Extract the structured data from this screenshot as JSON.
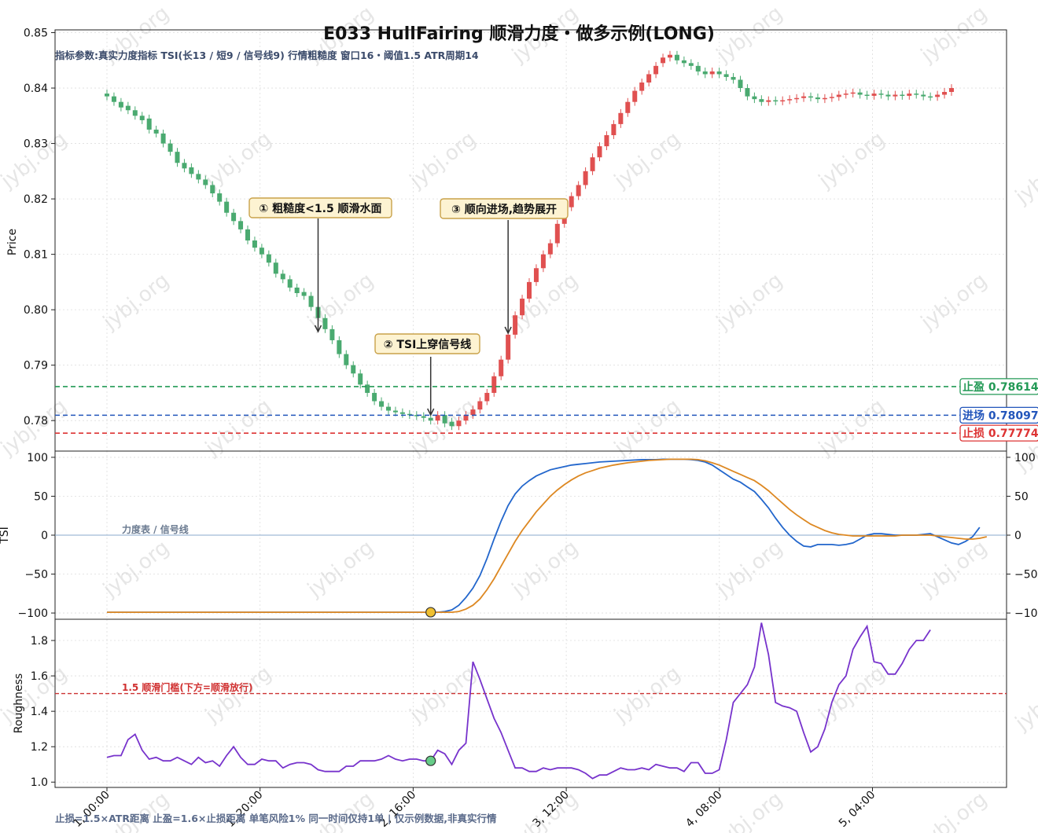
{
  "title": "E033 HullFairing 顺滑力度・做多示例(LONG)",
  "subtitle": "指标参数:真实力度指标 TSI(长13 / 短9 / 信号线9)   行情粗糙度 窗口16・阈值1.5   ATR周期14",
  "footer": "止损=1.5×ATR距离   止盈=1.6×止损距离   单笔风险1%   同一时间仅持1单   |   仅示例数据,非真实行情",
  "watermark": "jybj.org",
  "colors": {
    "up": "#e05050",
    "down": "#4aaa70",
    "tsi": "#2266cc",
    "signal": "#dd8822",
    "rough": "#7733cc",
    "tp": "#229955",
    "entry": "#2255bb",
    "sl": "#dd3333"
  },
  "chart_data": [
    {
      "type": "candlestick",
      "panel": "price",
      "ylabel": "Price",
      "ylim": [
        0.7745,
        0.8505
      ],
      "yticks": [
        "0.78",
        "0.79",
        "0.80",
        "0.81",
        "0.82",
        "0.83",
        "0.84",
        "0.85"
      ],
      "xticks": [
        "1, 00:00",
        "1, 20:00",
        "2, 16:00",
        "3, 12:00",
        "4, 08:00",
        "5, 04:00"
      ],
      "series_note": "121 hourly candles, values read off the chart",
      "lines": [
        {
          "name": "止盈",
          "value": 0.78614,
          "label": "止盈 0.78614"
        },
        {
          "name": "进场",
          "value": 0.78097,
          "label": "进场 0.78097"
        },
        {
          "name": "止损",
          "value": 0.77774,
          "label": "止损 0.77774"
        }
      ],
      "annotations": [
        {
          "text": "① 粗糙度<1.5 顺滑水面",
          "index": 30
        },
        {
          "text": "② TSI上穿信号线",
          "index": 46
        },
        {
          "text": "③ 顺向进场,趋势展开",
          "index": 57
        }
      ],
      "closes": [
        0.8385,
        0.8375,
        0.8365,
        0.836,
        0.835,
        0.8342,
        0.8325,
        0.8318,
        0.83,
        0.8285,
        0.8265,
        0.8255,
        0.8245,
        0.8235,
        0.8225,
        0.821,
        0.8195,
        0.8175,
        0.816,
        0.8145,
        0.8125,
        0.8112,
        0.81,
        0.8085,
        0.8065,
        0.8055,
        0.804,
        0.803,
        0.8025,
        0.8005,
        0.7985,
        0.7965,
        0.7945,
        0.792,
        0.79,
        0.7885,
        0.7865,
        0.785,
        0.7835,
        0.7825,
        0.7818,
        0.7815,
        0.7812,
        0.781,
        0.7808,
        0.7805,
        0.78,
        0.781,
        0.7795,
        0.779,
        0.78,
        0.781,
        0.782,
        0.7835,
        0.785,
        0.788,
        0.791,
        0.7955,
        0.799,
        0.802,
        0.805,
        0.8075,
        0.81,
        0.812,
        0.8155,
        0.8185,
        0.8205,
        0.8225,
        0.825,
        0.8275,
        0.8295,
        0.8315,
        0.8335,
        0.8355,
        0.8375,
        0.8395,
        0.841,
        0.8425,
        0.844,
        0.8455,
        0.846,
        0.845,
        0.8445,
        0.844,
        0.843,
        0.8425,
        0.843,
        0.8425,
        0.842,
        0.8415,
        0.84,
        0.8385,
        0.838,
        0.8375,
        0.8378,
        0.8376,
        0.8378,
        0.838,
        0.8382,
        0.8385,
        0.8383,
        0.838,
        0.8382,
        0.8384,
        0.8388,
        0.839,
        0.8392,
        0.8388,
        0.8386,
        0.839,
        0.8388,
        0.8385,
        0.8388,
        0.8386,
        0.839,
        0.8388,
        0.8385,
        0.8384,
        0.8388,
        0.8393,
        0.84
      ],
      "opens": [
        0.839,
        0.8385,
        0.8375,
        0.8368,
        0.836,
        0.835,
        0.8345,
        0.8325,
        0.8318,
        0.83,
        0.8285,
        0.8265,
        0.8257,
        0.8245,
        0.8235,
        0.8225,
        0.821,
        0.8195,
        0.8175,
        0.816,
        0.8145,
        0.8125,
        0.8112,
        0.81,
        0.8085,
        0.8065,
        0.8055,
        0.804,
        0.8032,
        0.8025,
        0.8005,
        0.7985,
        0.7965,
        0.7945,
        0.792,
        0.79,
        0.7885,
        0.7865,
        0.785,
        0.7835,
        0.7825,
        0.7818,
        0.7815,
        0.7812,
        0.781,
        0.7808,
        0.7805,
        0.78,
        0.781,
        0.7798,
        0.779,
        0.78,
        0.781,
        0.782,
        0.7835,
        0.785,
        0.788,
        0.791,
        0.7955,
        0.799,
        0.802,
        0.805,
        0.8075,
        0.81,
        0.812,
        0.8155,
        0.8185,
        0.8205,
        0.8225,
        0.825,
        0.8275,
        0.8295,
        0.8315,
        0.8335,
        0.8355,
        0.8375,
        0.8395,
        0.841,
        0.8425,
        0.8445,
        0.8455,
        0.846,
        0.845,
        0.8445,
        0.844,
        0.843,
        0.8425,
        0.843,
        0.8425,
        0.842,
        0.8415,
        0.84,
        0.8385,
        0.838,
        0.8375,
        0.8378,
        0.8376,
        0.8378,
        0.838,
        0.8382,
        0.8385,
        0.8383,
        0.838,
        0.8382,
        0.8384,
        0.8388,
        0.839,
        0.8392,
        0.8388,
        0.8386,
        0.839,
        0.8388,
        0.8385,
        0.8388,
        0.8386,
        0.839,
        0.8388,
        0.8385,
        0.8384,
        0.8388,
        0.8393
      ]
    },
    {
      "type": "line",
      "panel": "tsi",
      "ylabel": "TSI",
      "label": "力度表 / 信号线",
      "ylim": [
        -108,
        108
      ],
      "yticks": [
        "100",
        "50",
        "0",
        "−50",
        "−100"
      ],
      "cross_index": 46,
      "series": [
        {
          "key": "tsi",
          "values": [
            -99,
            -99,
            -99,
            -99,
            -99,
            -99,
            -99,
            -99,
            -99,
            -99,
            -99,
            -99,
            -99,
            -99,
            -99,
            -99,
            -99,
            -99,
            -99,
            -99,
            -99,
            -99,
            -99,
            -99,
            -99,
            -99,
            -99,
            -99,
            -99,
            -99,
            -99,
            -99,
            -99,
            -99,
            -99,
            -99,
            -99,
            -99,
            -99,
            -99,
            -99,
            -99,
            -99,
            -99,
            -99,
            -99,
            -99,
            -99,
            -98,
            -96,
            -90,
            -80,
            -68,
            -52,
            -30,
            -5,
            18,
            38,
            53,
            63,
            70,
            76,
            80,
            84,
            86,
            88,
            90,
            91,
            92,
            93,
            94,
            94.5,
            95,
            95.5,
            96,
            96.5,
            97,
            97,
            97,
            97.5,
            97.5,
            97.5,
            97.5,
            97,
            96,
            94,
            90,
            84,
            78,
            72,
            68,
            62,
            56,
            46,
            35,
            22,
            10,
            0,
            -8,
            -14,
            -15,
            -12,
            -12,
            -12,
            -13,
            -12,
            -10,
            -5,
            0,
            2,
            2,
            1,
            0,
            0,
            0,
            0,
            1,
            2,
            -2,
            -6,
            -10,
            -12,
            -8,
            -2,
            10
          ]
        },
        {
          "key": "signal",
          "values": [
            -99,
            -99,
            -99,
            -99,
            -99,
            -99,
            -99,
            -99,
            -99,
            -99,
            -99,
            -99,
            -99,
            -99,
            -99,
            -99,
            -99,
            -99,
            -99,
            -99,
            -99,
            -99,
            -99,
            -99,
            -99,
            -99,
            -99,
            -99,
            -99,
            -99,
            -99,
            -99,
            -99,
            -99,
            -99,
            -99,
            -99,
            -99,
            -99,
            -99,
            -99,
            -99,
            -99,
            -99,
            -99,
            -99,
            -99,
            -99,
            -99,
            -99,
            -98,
            -95,
            -90,
            -82,
            -70,
            -56,
            -40,
            -24,
            -8,
            6,
            18,
            30,
            40,
            50,
            58,
            65,
            71,
            76,
            80,
            83,
            86,
            88,
            90,
            91.5,
            93,
            94,
            95,
            96,
            96.5,
            97,
            97.5,
            97.5,
            97.5,
            97.5,
            97,
            95.5,
            93,
            90,
            86,
            82,
            78,
            74,
            70,
            64,
            57,
            49,
            41,
            33,
            26,
            20,
            14,
            10,
            6,
            3,
            1,
            0,
            -1,
            -1,
            -1,
            -1,
            -1,
            -1,
            -1,
            0,
            0,
            0,
            0,
            0,
            -1,
            -2,
            -3,
            -4,
            -5,
            -5,
            -4,
            -2
          ]
        }
      ]
    },
    {
      "type": "line",
      "panel": "roughness",
      "ylabel": "Roughness",
      "label": "1.5 顺滑门槛(下方=顺滑放行)",
      "threshold": 1.5,
      "ylim": [
        0.97,
        1.92
      ],
      "yticks": [
        "1.0",
        "1.2",
        "1.4",
        "1.6",
        "1.8"
      ],
      "marker_index": 46,
      "values": [
        1.14,
        1.15,
        1.15,
        1.24,
        1.27,
        1.18,
        1.13,
        1.14,
        1.12,
        1.12,
        1.14,
        1.12,
        1.1,
        1.14,
        1.11,
        1.12,
        1.09,
        1.15,
        1.2,
        1.14,
        1.1,
        1.1,
        1.13,
        1.12,
        1.12,
        1.08,
        1.1,
        1.11,
        1.11,
        1.1,
        1.07,
        1.06,
        1.06,
        1.06,
        1.09,
        1.09,
        1.12,
        1.12,
        1.12,
        1.13,
        1.15,
        1.13,
        1.12,
        1.13,
        1.13,
        1.12,
        1.12,
        1.18,
        1.16,
        1.1,
        1.18,
        1.22,
        1.68,
        1.58,
        1.47,
        1.36,
        1.28,
        1.18,
        1.08,
        1.08,
        1.06,
        1.06,
        1.08,
        1.07,
        1.08,
        1.08,
        1.08,
        1.07,
        1.05,
        1.02,
        1.04,
        1.04,
        1.06,
        1.08,
        1.07,
        1.07,
        1.08,
        1.07,
        1.1,
        1.09,
        1.08,
        1.08,
        1.06,
        1.11,
        1.11,
        1.05,
        1.05,
        1.07,
        1.24,
        1.45,
        1.5,
        1.55,
        1.65,
        1.9,
        1.72,
        1.45,
        1.43,
        1.42,
        1.4,
        1.28,
        1.17,
        1.2,
        1.3,
        1.45,
        1.55,
        1.6,
        1.75,
        1.82,
        1.88,
        1.68,
        1.67,
        1.61,
        1.61,
        1.67,
        1.75,
        1.8,
        1.8,
        1.86
      ]
    }
  ]
}
